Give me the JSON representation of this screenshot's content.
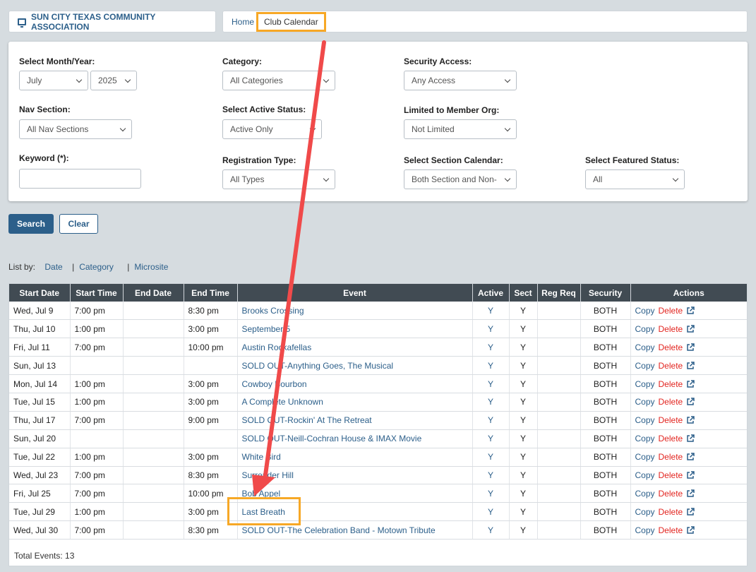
{
  "brand": {
    "title": "SUN CITY TEXAS COMMUNITY ASSOCIATION"
  },
  "breadcrumb": {
    "home": "Home",
    "current": "Club Calendar"
  },
  "filters": {
    "month_year": {
      "label": "Select Month/Year:",
      "month": "July",
      "year": "2025"
    },
    "category": {
      "label": "Category:",
      "value": "All Categories"
    },
    "security": {
      "label": "Security Access:",
      "value": "Any Access"
    },
    "nav_section": {
      "label": "Nav Section:",
      "value": "All Nav Sections"
    },
    "active_status": {
      "label": "Select Active Status:",
      "value": "Active Only"
    },
    "member_org": {
      "label": "Limited to Member Org:",
      "value": "Not Limited"
    },
    "keyword": {
      "label": "Keyword (*):",
      "value": ""
    },
    "registration_type": {
      "label": "Registration Type:",
      "value": "All Types"
    },
    "section_calendar": {
      "label": "Select Section Calendar:",
      "value": "Both Section and Non-"
    },
    "featured_status": {
      "label": "Select Featured Status:",
      "value": "All"
    }
  },
  "buttons": {
    "search": "Search",
    "clear": "Clear"
  },
  "list_by": {
    "label": "List by:",
    "date": "Date",
    "category": "Category",
    "microsite": "Microsite"
  },
  "table": {
    "headers": [
      "Start Date",
      "Start Time",
      "End Date",
      "End Time",
      "Event",
      "Active",
      "Sect",
      "Reg Req",
      "Security",
      "Actions"
    ],
    "copy_label": "Copy",
    "delete_label": "Delete",
    "rows": [
      {
        "start_date": "Wed, Jul 9",
        "start_time": "7:00 pm",
        "end_date": "",
        "end_time": "8:30 pm",
        "event": "Brooks Crossing",
        "active": "Y",
        "sect": "Y",
        "reg_req": "",
        "security": "BOTH"
      },
      {
        "start_date": "Thu, Jul 10",
        "start_time": "1:00 pm",
        "end_date": "",
        "end_time": "3:00 pm",
        "event": "September 5",
        "active": "Y",
        "sect": "Y",
        "reg_req": "",
        "security": "BOTH"
      },
      {
        "start_date": "Fri, Jul 11",
        "start_time": "7:00 pm",
        "end_date": "",
        "end_time": "10:00 pm",
        "event": "Austin Rockafellas",
        "active": "Y",
        "sect": "Y",
        "reg_req": "",
        "security": "BOTH"
      },
      {
        "start_date": "Sun, Jul 13",
        "start_time": "",
        "end_date": "",
        "end_time": "",
        "event": "SOLD OUT-Anything Goes, The Musical",
        "active": "Y",
        "sect": "Y",
        "reg_req": "",
        "security": "BOTH"
      },
      {
        "start_date": "Mon, Jul 14",
        "start_time": "1:00 pm",
        "end_date": "",
        "end_time": "3:00 pm",
        "event": "Cowboy Bourbon",
        "active": "Y",
        "sect": "Y",
        "reg_req": "",
        "security": "BOTH"
      },
      {
        "start_date": "Tue, Jul 15",
        "start_time": "1:00 pm",
        "end_date": "",
        "end_time": "3:00 pm",
        "event": "A Complete Unknown",
        "active": "Y",
        "sect": "Y",
        "reg_req": "",
        "security": "BOTH"
      },
      {
        "start_date": "Thu, Jul 17",
        "start_time": "7:00 pm",
        "end_date": "",
        "end_time": "9:00 pm",
        "event": "SOLD OUT-Rockin' At The Retreat",
        "active": "Y",
        "sect": "Y",
        "reg_req": "",
        "security": "BOTH"
      },
      {
        "start_date": "Sun, Jul 20",
        "start_time": "",
        "end_date": "",
        "end_time": "",
        "event": "SOLD OUT-Neill-Cochran House & IMAX Movie",
        "active": "Y",
        "sect": "Y",
        "reg_req": "",
        "security": "BOTH"
      },
      {
        "start_date": "Tue, Jul 22",
        "start_time": "1:00 pm",
        "end_date": "",
        "end_time": "3:00 pm",
        "event": "White Bird",
        "active": "Y",
        "sect": "Y",
        "reg_req": "",
        "security": "BOTH"
      },
      {
        "start_date": "Wed, Jul 23",
        "start_time": "7:00 pm",
        "end_date": "",
        "end_time": "8:30 pm",
        "event": "Surrender Hill",
        "active": "Y",
        "sect": "Y",
        "reg_req": "",
        "security": "BOTH"
      },
      {
        "start_date": "Fri, Jul 25",
        "start_time": "7:00 pm",
        "end_date": "",
        "end_time": "10:00 pm",
        "event": "Bob Appel",
        "active": "Y",
        "sect": "Y",
        "reg_req": "",
        "security": "BOTH"
      },
      {
        "start_date": "Tue, Jul 29",
        "start_time": "1:00 pm",
        "end_date": "",
        "end_time": "3:00 pm",
        "event": "Last Breath",
        "active": "Y",
        "sect": "Y",
        "reg_req": "",
        "security": "BOTH"
      },
      {
        "start_date": "Wed, Jul 30",
        "start_time": "7:00 pm",
        "end_date": "",
        "end_time": "8:30 pm",
        "event": "SOLD OUT-The Celebration Band - Motown Tribute",
        "active": "Y",
        "sect": "Y",
        "reg_req": "",
        "security": "BOTH"
      }
    ],
    "total_label": "Total Events: 13"
  },
  "colors": {
    "accent": "#2c5f8a",
    "highlight": "#f7a826",
    "arrow": "#f04a4a",
    "delete": "#e2241f",
    "header_bg": "#414b53"
  }
}
